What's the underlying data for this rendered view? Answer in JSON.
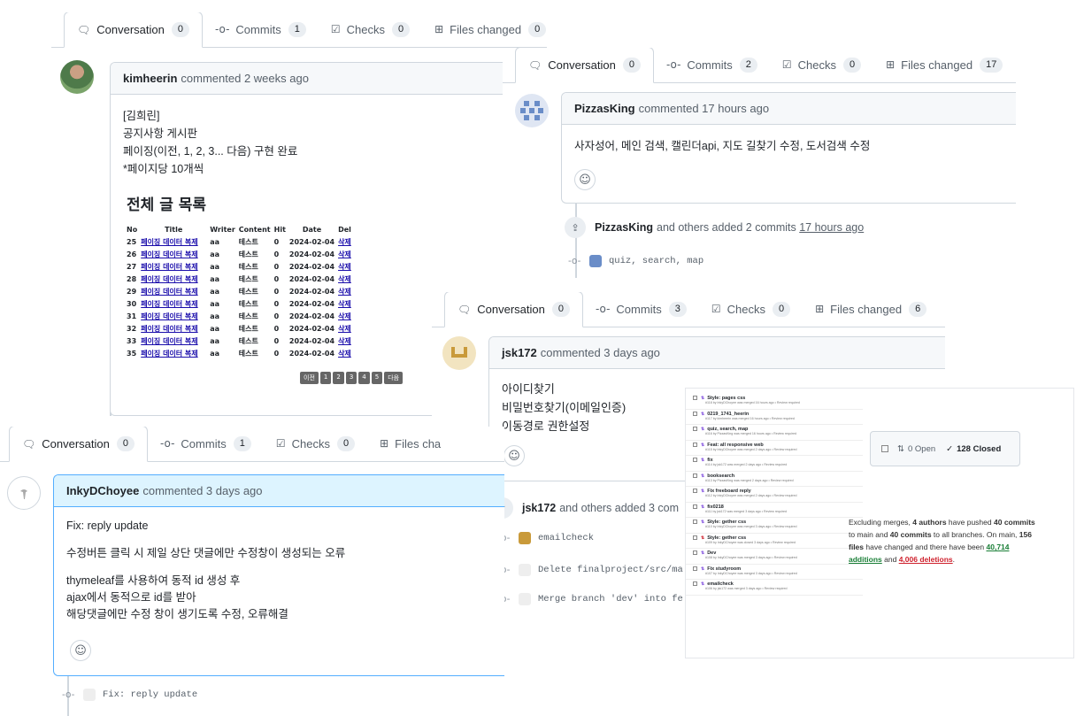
{
  "p1": {
    "tabs": [
      {
        "label": "Conversation",
        "count": "0",
        "icon": "comment-icon"
      },
      {
        "label": "Commits",
        "count": "1",
        "icon": "commit-icon"
      },
      {
        "label": "Checks",
        "count": "0",
        "icon": "checks-icon"
      },
      {
        "label": "Files changed",
        "count": "0",
        "icon": "file-diff-icon"
      }
    ],
    "author": "kimheerin",
    "action": "commented 2 weeks ago",
    "body": [
      "[김희린]",
      "공지사항 게시판",
      "페이징(이전, 1, 2, 3... 다음) 구현 완료",
      "*페이지당 10개씩"
    ],
    "board_title": "전체 글 목록",
    "headers": [
      "No",
      "Title",
      "Writer",
      "Content",
      "Hit",
      "Date",
      "Del"
    ],
    "rows": [
      [
        "25",
        "페이징 데이터 복제",
        "aa",
        "테스트",
        "0",
        "2024-02-04",
        "삭제"
      ],
      [
        "26",
        "페이징 데이터 복제",
        "aa",
        "테스트",
        "0",
        "2024-02-04",
        "삭제"
      ],
      [
        "27",
        "페이징 데이터 복제",
        "aa",
        "테스트",
        "0",
        "2024-02-04",
        "삭제"
      ],
      [
        "28",
        "페이징 데이터 복제",
        "aa",
        "테스트",
        "0",
        "2024-02-04",
        "삭제"
      ],
      [
        "29",
        "페이징 데이터 복제",
        "aa",
        "테스트",
        "0",
        "2024-02-04",
        "삭제"
      ],
      [
        "30",
        "페이징 데이터 복제",
        "aa",
        "테스트",
        "0",
        "2024-02-04",
        "삭제"
      ],
      [
        "31",
        "페이징 데이터 복제",
        "aa",
        "테스트",
        "0",
        "2024-02-04",
        "삭제"
      ],
      [
        "32",
        "페이징 데이터 복제",
        "aa",
        "테스트",
        "0",
        "2024-02-04",
        "삭제"
      ],
      [
        "33",
        "페이징 데이터 복제",
        "aa",
        "테스트",
        "0",
        "2024-02-04",
        "삭제"
      ],
      [
        "35",
        "페이징 데이터 복제",
        "aa",
        "테스트",
        "0",
        "2024-02-04",
        "삭제"
      ]
    ],
    "pager": [
      "이전",
      "1",
      "2",
      "3",
      "4",
      "5",
      "다음"
    ]
  },
  "p2": {
    "tabs": [
      {
        "label": "Conversation",
        "count": "0"
      },
      {
        "label": "Commits",
        "count": "2"
      },
      {
        "label": "Checks",
        "count": "0"
      },
      {
        "label": "Files changed",
        "count": "17"
      }
    ],
    "author": "PizzasKing",
    "action": "commented 17 hours ago",
    "body": "사자성어, 메인 검색, 캘린더api, 지도 길찾기 수정, 도서검색 수정",
    "event_author": "PizzasKing",
    "event_text": "and others added 2 commits",
    "event_time": "17 hours ago",
    "commit": "quiz, search, map"
  },
  "p3": {
    "tabs": [
      {
        "label": "Conversation",
        "count": "0"
      },
      {
        "label": "Commits",
        "count": "3"
      },
      {
        "label": "Checks",
        "count": "0"
      },
      {
        "label": "Files changed",
        "count": "6"
      }
    ],
    "author": "jsk172",
    "action": "commented 3 days ago",
    "body": [
      "아이디찾기",
      "비밀번호찾기(이메일인증)",
      "이동경로 권한설정"
    ],
    "event_author": "jsk172",
    "event_text": "and others added 3 com",
    "commits": [
      "emailcheck",
      "Delete finalproject/src/ma",
      "Merge branch 'dev' into fe"
    ]
  },
  "p4": {
    "tabs": [
      {
        "label": "Conversation",
        "count": "0"
      },
      {
        "label": "Commits",
        "count": "1"
      },
      {
        "label": "Checks",
        "count": "0"
      },
      {
        "label": "Files cha"
      }
    ],
    "author": "InkyDChoyee",
    "action": "commented 3 days ago",
    "body": [
      "Fix: reply update",
      "수정버튼 클릭 시 제일 상단 댓글에만 수정창이 생성되는 오류",
      "thymeleaf를 사용하여 동적 id 생성 후",
      "ajax에서 동적으로 id를 받아",
      "해당댓글에만 수정 창이 생기도록 수정, 오류해결"
    ],
    "commit": "Fix: reply update"
  },
  "p5": {
    "items": [
      {
        "t": "Style: pages css",
        "m": "#118 by InkyDChoyee was merged 16 hours ago • Review required",
        "closed": false
      },
      {
        "t": "0219_1741_heerin",
        "m": "#117 by kimheerin was merged 16 hours ago • Review required",
        "closed": false
      },
      {
        "t": "quiz, search, map",
        "m": "#116 by PizzasKing was merged 16 hours ago • Review required",
        "closed": false
      },
      {
        "t": "Feat: all responsive web",
        "m": "#115 by InkyDChoyee was merged 2 days ago • Review required",
        "closed": false
      },
      {
        "t": "fix",
        "m": "#114 by jsk172 was merged 2 days ago • Review required",
        "closed": false
      },
      {
        "t": "booksearch",
        "m": "#113 by PizzasKing was merged 2 days ago • Review required",
        "closed": false
      },
      {
        "t": "Fix freeboard reply",
        "m": "#112 by InkyDChoyee was merged 2 days ago • Review required",
        "closed": false
      },
      {
        "t": "fix0218",
        "m": "#111 by jsk172 was merged 3 days ago • Review required",
        "closed": false
      },
      {
        "t": "Style: gether css",
        "m": "#110 by InkyDChoyee was merged 3 days ago • Review required",
        "closed": false
      },
      {
        "t": "Style: gether css",
        "m": "#109 by InkyDChoyee was closed 3 days ago • Review required",
        "closed": true
      },
      {
        "t": "Dev",
        "m": "#108 by InkyDChoyee was merged 3 days ago • Review required",
        "closed": false
      },
      {
        "t": "Fix studyroom",
        "m": "#107 by InkyDChoyee was merged 3 days ago • Review required",
        "closed": false
      },
      {
        "t": "emailcheck",
        "m": "#106 by jsk172 was merged 3 days ago • Review required",
        "closed": false
      }
    ],
    "open_label": "0 Open",
    "closed_label": "128 Closed",
    "stats": {
      "a": "Excluding merges, ",
      "b": "4 authors",
      "c": " have pushed ",
      "d": "40",
      "e": "commits",
      "f": " to main and ",
      "g": "40 commits",
      "h": " to all branches. On main, ",
      "i": "156 files",
      "j": " have changed and there have been ",
      "k": "40,714 additions",
      "l": " and ",
      "m": "4,006 deletions",
      "n": "."
    }
  }
}
